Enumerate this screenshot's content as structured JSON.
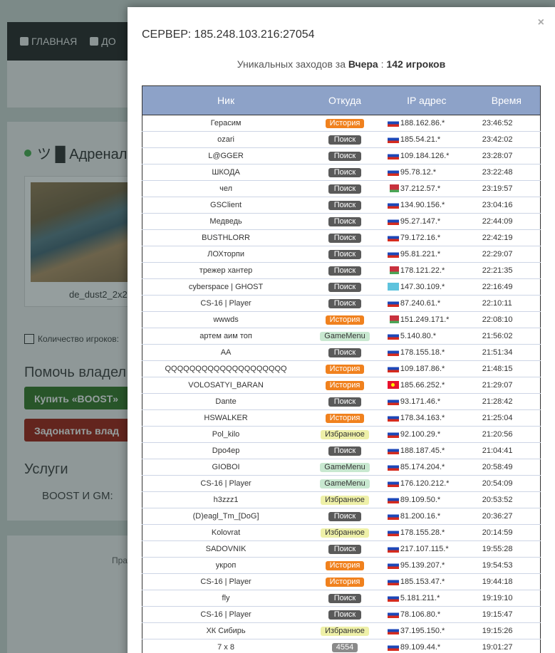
{
  "background": {
    "nav": {
      "home_label": "ГЛАВНАЯ",
      "add_label": "ДО"
    },
    "server_title": "ツ █ Адренал",
    "map_name": "de_dust2_2x2",
    "players_label": "Количество игроков:",
    "help_title": "Помочь владел",
    "boost_button": "Купить «BOOST»",
    "donate_button": "Задонатить влад",
    "services_title": "Услуги",
    "boost_gm_label": "BOOST И GM:",
    "pra_label": "Пра"
  },
  "modal": {
    "server_label": "СЕРВЕР: 185.248.103.216:27054",
    "unique_prefix": "Уникальных заходов за",
    "unique_period": "Вчера",
    "unique_separator": ":",
    "unique_count": "142 игроков",
    "close_glyph": "×",
    "columns": [
      "Ник",
      "Откуда",
      "IP адрес",
      "Время"
    ],
    "rows": [
      {
        "nick": "Герасим",
        "source": "История",
        "type": "history",
        "flag": "ru",
        "ip": "188.162.86.*",
        "time": "23:46:52"
      },
      {
        "nick": "ozari",
        "source": "Поиск",
        "type": "search",
        "flag": "ru",
        "ip": "185.54.21.*",
        "time": "23:42:02"
      },
      {
        "nick": "L@GGER",
        "source": "Поиск",
        "type": "search",
        "flag": "ru",
        "ip": "109.184.126.*",
        "time": "23:28:07"
      },
      {
        "nick": "ШКОДА",
        "source": "Поиск",
        "type": "search",
        "flag": "ru",
        "ip": "95.78.12.*",
        "time": "23:22:48"
      },
      {
        "nick": "чел",
        "source": "Поиск",
        "type": "search",
        "flag": "by",
        "ip": "37.212.57.*",
        "time": "23:19:57"
      },
      {
        "nick": "GSClient",
        "source": "Поиск",
        "type": "search",
        "flag": "ru",
        "ip": "134.90.156.*",
        "time": "23:04:16"
      },
      {
        "nick": "Медведь",
        "source": "Поиск",
        "type": "search",
        "flag": "ru",
        "ip": "95.27.147.*",
        "time": "22:44:09"
      },
      {
        "nick": "BUSTHLORR",
        "source": "Поиск",
        "type": "search",
        "flag": "ru",
        "ip": "79.172.16.*",
        "time": "22:42:19"
      },
      {
        "nick": "ЛОХторпи",
        "source": "Поиск",
        "type": "search",
        "flag": "ru",
        "ip": "95.81.221.*",
        "time": "22:29:07"
      },
      {
        "nick": "трежер хантер",
        "source": "Поиск",
        "type": "search",
        "flag": "by",
        "ip": "178.121.22.*",
        "time": "22:21:35"
      },
      {
        "nick": "cyberspace | GHOST",
        "source": "Поиск",
        "type": "search",
        "flag": "kz",
        "ip": "147.30.109.*",
        "time": "22:16:49"
      },
      {
        "nick": "CS-16 | Player",
        "source": "Поиск",
        "type": "search",
        "flag": "ru",
        "ip": "87.240.61.*",
        "time": "22:10:11"
      },
      {
        "nick": "wwwds",
        "source": "История",
        "type": "history",
        "flag": "by",
        "ip": "151.249.171.*",
        "time": "22:08:10"
      },
      {
        "nick": "артем аим топ",
        "source": "GameMenu",
        "type": "gamemenu",
        "flag": "ru",
        "ip": "5.140.80.*",
        "time": "21:56:02"
      },
      {
        "nick": "AA",
        "source": "Поиск",
        "type": "search",
        "flag": "ru",
        "ip": "178.155.18.*",
        "time": "21:51:34"
      },
      {
        "nick": "QQQQQQQQQQQQQQQQQQQQ",
        "source": "История",
        "type": "history",
        "flag": "ru",
        "ip": "109.187.86.*",
        "time": "21:48:15"
      },
      {
        "nick": "VOLOSATYI_BARAN",
        "source": "История",
        "type": "history",
        "flag": "kg",
        "ip": "185.66.252.*",
        "time": "21:29:07"
      },
      {
        "nick": "Dante",
        "source": "Поиск",
        "type": "search",
        "flag": "ru",
        "ip": "93.171.46.*",
        "time": "21:28:42"
      },
      {
        "nick": "HSWALKER",
        "source": "История",
        "type": "history",
        "flag": "ru",
        "ip": "178.34.163.*",
        "time": "21:25:04"
      },
      {
        "nick": "Pol_kilo",
        "source": "Избранное",
        "type": "fav",
        "flag": "ru",
        "ip": "92.100.29.*",
        "time": "21:20:56"
      },
      {
        "nick": "Dpo4ep",
        "source": "Поиск",
        "type": "search",
        "flag": "ru",
        "ip": "188.187.45.*",
        "time": "21:04:41"
      },
      {
        "nick": "GIOBOI",
        "source": "GameMenu",
        "type": "gamemenu",
        "flag": "ru",
        "ip": "85.174.204.*",
        "time": "20:58:49"
      },
      {
        "nick": "CS-16 | Player",
        "source": "GameMenu",
        "type": "gamemenu",
        "flag": "ru",
        "ip": "176.120.212.*",
        "time": "20:54:09"
      },
      {
        "nick": "h3zzz1",
        "source": "Избранное",
        "type": "fav",
        "flag": "ru",
        "ip": "89.109.50.*",
        "time": "20:53:52"
      },
      {
        "nick": "(D)eagl_Tm_[DoG]",
        "source": "Поиск",
        "type": "search",
        "flag": "ru",
        "ip": "81.200.16.*",
        "time": "20:36:27"
      },
      {
        "nick": "Kolovrat",
        "source": "Избранное",
        "type": "fav",
        "flag": "ru",
        "ip": "178.155.28.*",
        "time": "20:14:59"
      },
      {
        "nick": "SADOVNIK",
        "source": "Поиск",
        "type": "search",
        "flag": "ru",
        "ip": "217.107.115.*",
        "time": "19:55:28"
      },
      {
        "nick": "укроп",
        "source": "История",
        "type": "history",
        "flag": "ru",
        "ip": "95.139.207.*",
        "time": "19:54:53"
      },
      {
        "nick": "CS-16 | Player",
        "source": "История",
        "type": "history",
        "flag": "ru",
        "ip": "185.153.47.*",
        "time": "19:44:18"
      },
      {
        "nick": "fly",
        "source": "Поиск",
        "type": "search",
        "flag": "ru",
        "ip": "5.181.211.*",
        "time": "19:19:10"
      },
      {
        "nick": "CS-16 | Player",
        "source": "Поиск",
        "type": "search",
        "flag": "ru",
        "ip": "78.106.80.*",
        "time": "19:15:47"
      },
      {
        "nick": "ХК Сибирь",
        "source": "Избранное",
        "type": "fav",
        "flag": "ru",
        "ip": "37.195.150.*",
        "time": "19:15:26"
      },
      {
        "nick": "7 x 8",
        "source": "4554",
        "type": "num",
        "flag": "ru",
        "ip": "89.109.44.*",
        "time": "19:01:27"
      }
    ]
  }
}
